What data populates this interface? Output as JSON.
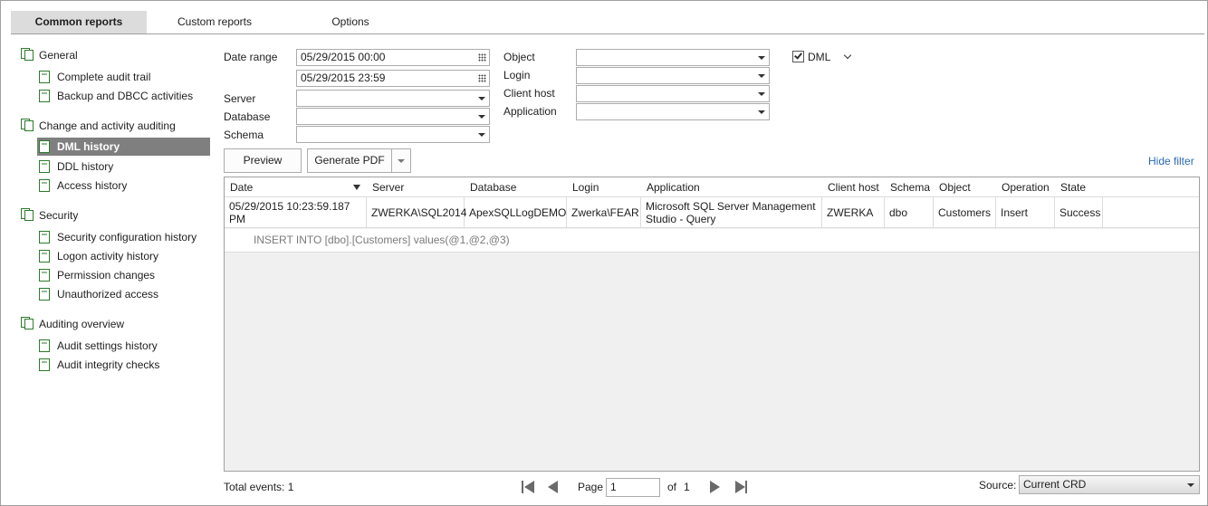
{
  "tabs": [
    {
      "label": "Common reports"
    },
    {
      "label": "Custom reports"
    },
    {
      "label": "Options"
    }
  ],
  "sidebar": {
    "groups": [
      {
        "label": "General",
        "items": [
          {
            "label": "Complete audit trail"
          },
          {
            "label": "Backup and DBCC activities"
          }
        ]
      },
      {
        "label": "Change and activity auditing",
        "items": [
          {
            "label": "DML history"
          },
          {
            "label": "DDL history"
          },
          {
            "label": "Access history"
          }
        ]
      },
      {
        "label": "Security",
        "items": [
          {
            "label": "Security configuration history"
          },
          {
            "label": "Logon activity history"
          },
          {
            "label": "Permission changes"
          },
          {
            "label": "Unauthorized access"
          }
        ]
      },
      {
        "label": "Auditing overview",
        "items": [
          {
            "label": "Audit settings history"
          },
          {
            "label": "Audit integrity checks"
          }
        ]
      }
    ],
    "selected": "DML history"
  },
  "filter": {
    "date_range_label": "Date range",
    "date_from": "05/29/2015 00:00",
    "date_to": "05/29/2015 23:59",
    "server_label": "Server",
    "server_value": "",
    "database_label": "Database",
    "database_value": "",
    "schema_label": "Schema",
    "schema_value": "",
    "object_label": "Object",
    "object_value": "",
    "login_label": "Login",
    "login_value": "",
    "client_host_label": "Client host",
    "client_host_value": "",
    "application_label": "Application",
    "application_value": "",
    "dml_label": "DML",
    "dml_checked": true
  },
  "actions": {
    "preview_label": "Preview",
    "generate_pdf_label": "Generate PDF",
    "hide_filter_label": "Hide filter"
  },
  "grid": {
    "columns": [
      "Date",
      "Server",
      "Database",
      "Login",
      "Application",
      "Client host",
      "Schema",
      "Object",
      "Operation",
      "State"
    ],
    "sort_column": "Date",
    "rows": [
      {
        "date": "05/29/2015 10:23:59.187 PM",
        "server": "ZWERKA\\SQL2014",
        "database": "ApexSQLLogDEMO",
        "login": "Zwerka\\FEAR",
        "application": "Microsoft SQL Server Management Studio - Query",
        "client_host": "ZWERKA",
        "schema": "dbo",
        "object": "Customers",
        "operation": "Insert",
        "state": "Success",
        "detail": "INSERT INTO [dbo].[Customers] values(@1,@2,@3)"
      }
    ]
  },
  "footer": {
    "total_events_label": "Total events: 1",
    "page_label": "Page",
    "page_value": "1",
    "of_label": "of",
    "page_count": "1",
    "source_label": "Source:",
    "source_value": "Current CRD"
  }
}
